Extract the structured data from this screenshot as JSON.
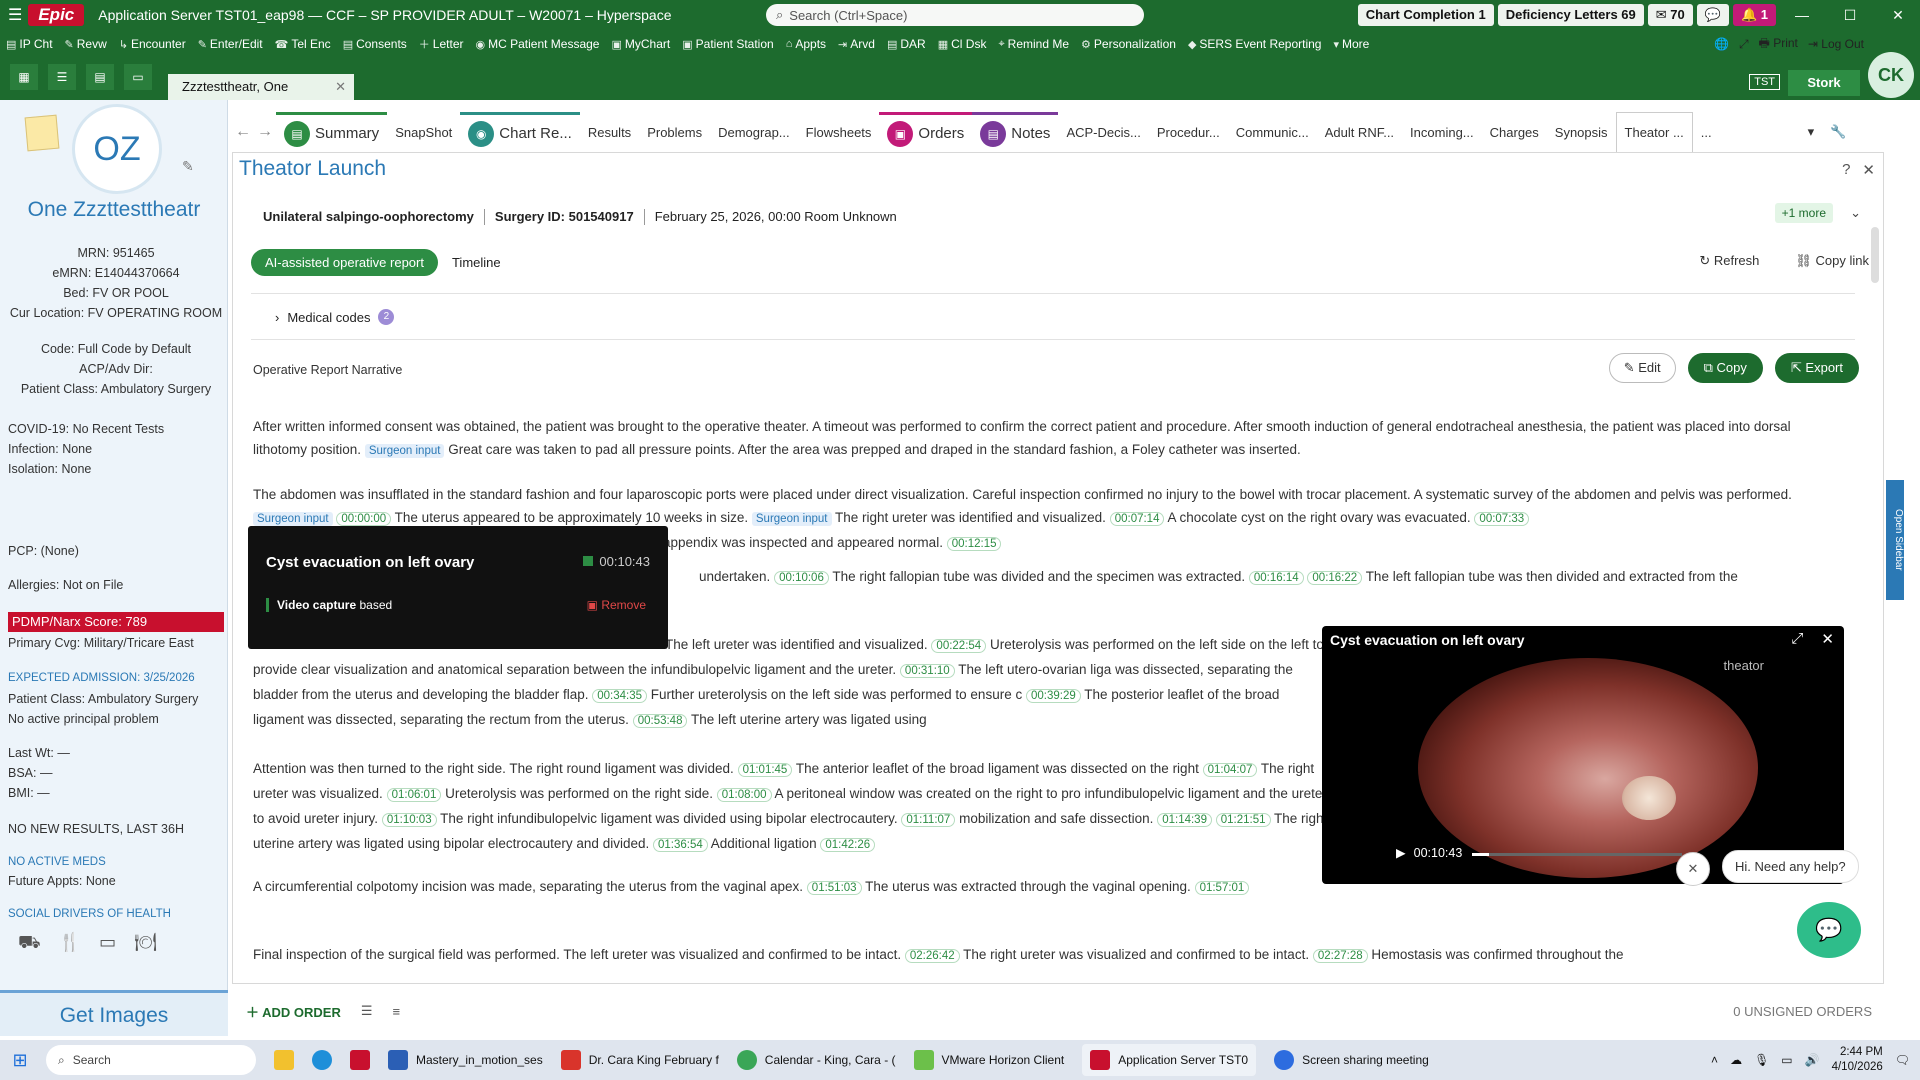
{
  "titlebar": {
    "app_title": "Application Server TST01_eap98 — CCF – SP PROVIDER ADULT – W20071 – Hyperspace",
    "logo": "Epic",
    "search_placeholder": "Search (Ctrl+Space)",
    "chart_completion": "Chart Completion 1",
    "deficiency_letters": "Deficiency Letters 69",
    "inbox_count": "70",
    "alerts_count": "1"
  },
  "toolbar": {
    "items": [
      "IP Cht",
      "Revw",
      "Encounter",
      "Enter/Edit",
      "Tel Enc",
      "Consents",
      "Letter",
      "MC Patient Message",
      "MyChart",
      "Patient Station",
      "Appts",
      "Arvd",
      "DAR",
      "Cl Dsk",
      "Remind Me",
      "Personalization",
      "SERS Event Reporting",
      "More"
    ],
    "print": "Print",
    "logout": "Log Out"
  },
  "user": {
    "initials": "CK",
    "environment": "TST",
    "dept": "Stork"
  },
  "patient_tab": "Zzztesttheatr, One",
  "patient": {
    "initials": "OZ",
    "name": "One Zzzttesttheatr",
    "mrn": "MRN: 951465",
    "emrn": "eMRN: E14044370664",
    "bed": "Bed: FV OR POOL",
    "cur_location": "Cur Location: FV OPERATING ROOM",
    "code": "Code: Full Code by Default",
    "acp": "ACP/Adv Dir:",
    "patient_class": "Patient Class: Ambulatory Surgery",
    "covid": "COVID-19: No Recent Tests",
    "infection": "Infection: None",
    "isolation": "Isolation: None",
    "pcp": "PCP: (None)",
    "allergies": "Allergies: Not on File",
    "pdmp": "PDMP/Narx Score: 789",
    "primary_cvg": "Primary Cvg: Military/Tricare East",
    "expected_admission": "EXPECTED ADMISSION: 3/25/2026",
    "patient_class_2": "Patient Class: Ambulatory Surgery",
    "no_problem": "No active principal problem",
    "last_wt": "Last Wt: —",
    "bsa": "BSA: —",
    "bmi": "BMI: —",
    "no_results": "NO NEW RESULTS, LAST 36H",
    "no_meds": "NO ACTIVE MEDS",
    "future_appts": "Future Appts: None",
    "sdoh": "SOCIAL DRIVERS OF HEALTH",
    "get_images": "Get Images"
  },
  "activity_tabs": [
    "Summary",
    "SnapShot",
    "Chart Re...",
    "Results",
    "Problems",
    "Demograp...",
    "Flowsheets",
    "Orders",
    "Notes",
    "ACP-Decis...",
    "Procedur...",
    "Communic...",
    "Adult RNF...",
    "Incoming...",
    "Charges",
    "Synopsis",
    "Theator ...",
    "..."
  ],
  "main": {
    "title": "Theator Launch",
    "procedure": "Unilateral salpingo-oophorectomy",
    "surgery_id": "Surgery ID: 501540917",
    "date_room": "February 25, 2026, 00:00 Room Unknown",
    "more": "+1 more",
    "seg_on": "AI-assisted operative report",
    "seg_off": "Timeline",
    "refresh": "Refresh",
    "copy_link": "Copy link",
    "medical_codes": "Medical codes",
    "medical_codes_count": "2",
    "op_report_title": "Operative Report Narrative",
    "edit": "Edit",
    "copy": "Copy",
    "export": "Export",
    "surgeon_input": "Surgeon input"
  },
  "narrative": {
    "p1a": "After written informed consent was obtained, the patient was brought to the operative theater. A timeout was performed to confirm the correct patient and procedure. After smooth induction of general endotracheal anesthesia, the patient was placed into dorsal lithotomy position.",
    "p1b": "Great care was taken to pad all pressure points. After the area was prepped and draped in the standard fashion, a Foley catheter was inserted.",
    "p2a": "The abdomen was insufflated in the standard fashion and four laparoscopic ports were placed under direct visualization. Careful inspection confirmed no injury to the bowel with trocar placement. A systematic survey of the abdomen and pelvis was performed.",
    "t1": "00:00:00",
    "p2b": "The uterus appeared to be approximately 10 weeks in size.",
    "p2c": "The right ureter was identified and visualized.",
    "t2": "00:07:14",
    "p2d": "A chocolate cyst on the right ovary was evacuated.",
    "t3": "00:07:33",
    "p2e": "appendix was inspected and appeared normal.",
    "t4": "00:12:15",
    "p3a": "undertaken.",
    "t5": "00:10:06",
    "p3b": "The right fallopian tube was divided and the specimen was extracted.",
    "t6": "00:16:14",
    "t7": "00:16:22",
    "p3c": "The left fallopian tube was then divided and extracted from the",
    "p4a": "The left ureter was identified and visualized.",
    "t8": "00:22:54",
    "p4b": "Ureterolysis was performed on the left side",
    "p4c": "on the left to provide clear visualization and anatomical separation between the infundibulopelvic ligament and the ureter.",
    "t9": "00:31:10",
    "p4d": "The left utero-ovarian liga",
    "p4e": "was dissected, separating the bladder from the uterus and developing the bladder flap.",
    "t10": "00:34:35",
    "p4f": "Further ureterolysis on the left side was performed to ensure c",
    "t11": "00:39:29",
    "p4g": "The posterior leaflet of the broad ligament was dissected, separating the rectum from the uterus.",
    "t12": "00:53:48",
    "p4h": "The left uterine artery was ligated using",
    "p5a": "Attention was then turned to the right side. The right round ligament was divided.",
    "t13": "01:01:45",
    "p5b": "The anterior leaflet of the broad ligament was dissected on the right",
    "t14": "01:04:07",
    "p5c": "The right ureter was visualized.",
    "t15": "01:06:01",
    "p5d": "Ureterolysis was performed on the right side.",
    "t16": "01:08:00",
    "p5e": "A peritoneal window was created on the right to pro",
    "p5f": "infundibulopelvic ligament and the ureter to avoid ureter injury.",
    "t17": "01:10:03",
    "p5g": "The right infundibulopelvic ligament was divided using bipolar electrocautery.",
    "t18": "01:11:07",
    "p5h": "mobilization and safe dissection.",
    "t19": "01:14:39",
    "t20": "01:21:51",
    "p5i": "The right uterine artery was ligated using bipolar electrocautery and divided.",
    "t21": "01:36:54",
    "p5j": "Additional ligation",
    "t22": "01:42:26",
    "p6a": "A circumferential colpotomy incision was made, separating the uterus from the vaginal apex.",
    "t23": "01:51:03",
    "p6b": "The uterus was extracted through the vaginal opening.",
    "t24": "01:57:01",
    "p7a": "Final inspection of the surgical field was performed. The left ureter was visualized and confirmed to be intact.",
    "t25": "02:26:42",
    "p7b": "The right ureter was visualized and confirmed to be intact.",
    "t26": "02:27:28",
    "p7c": "Hemostasis was confirmed throughout the"
  },
  "tooltip": {
    "title": "Cyst evacuation on left ovary",
    "time": "00:10:43",
    "source_bold": "Video capture",
    "source_rest": "based",
    "remove": "Remove"
  },
  "video": {
    "title": "Cyst evacuation on left ovary",
    "watermark": "theator",
    "time": "00:10:43",
    "progress": 0.08
  },
  "help": {
    "bubble": "Hi. Need any help?"
  },
  "open_sidebar": "Open Sidebar",
  "bottom": {
    "add_order": "ADD ORDER",
    "unsigned": "0 UNSIGNED ORDERS"
  },
  "taskbar": {
    "search": "Search",
    "apps": [
      "Mastery_in_motion_ses",
      "Dr. Cara King February f",
      "Calendar - King, Cara - (",
      "VMware Horizon Client",
      "Application Server TST0",
      "Screen sharing meeting"
    ],
    "time": "2:44 PM",
    "date": "4/10/2026"
  }
}
